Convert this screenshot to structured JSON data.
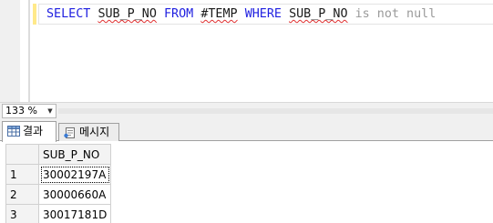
{
  "editor": {
    "sql": {
      "select": "SELECT",
      "column": "SUB_P_NO",
      "from": "FROM",
      "table": "#TEMP",
      "where": "WHERE",
      "filter_column": "SUB_P_NO",
      "condition": "is not null"
    }
  },
  "zoom": {
    "value": "133 %"
  },
  "tabs": [
    {
      "label": "결과",
      "icon": "grid-icon",
      "active": true
    },
    {
      "label": "메시지",
      "icon": "messages-icon",
      "active": false
    }
  ],
  "results": {
    "columns": [
      "SUB_P_NO"
    ],
    "rows": [
      {
        "num": "1",
        "value": "30002197A"
      },
      {
        "num": "2",
        "value": "30000660A"
      },
      {
        "num": "3",
        "value": "30017181D"
      }
    ]
  },
  "colors": {
    "keyword": "#1f1fe0",
    "operator": "#9a9a9a",
    "squiggle": "#e03030",
    "change_bar": "#ffe98a"
  }
}
